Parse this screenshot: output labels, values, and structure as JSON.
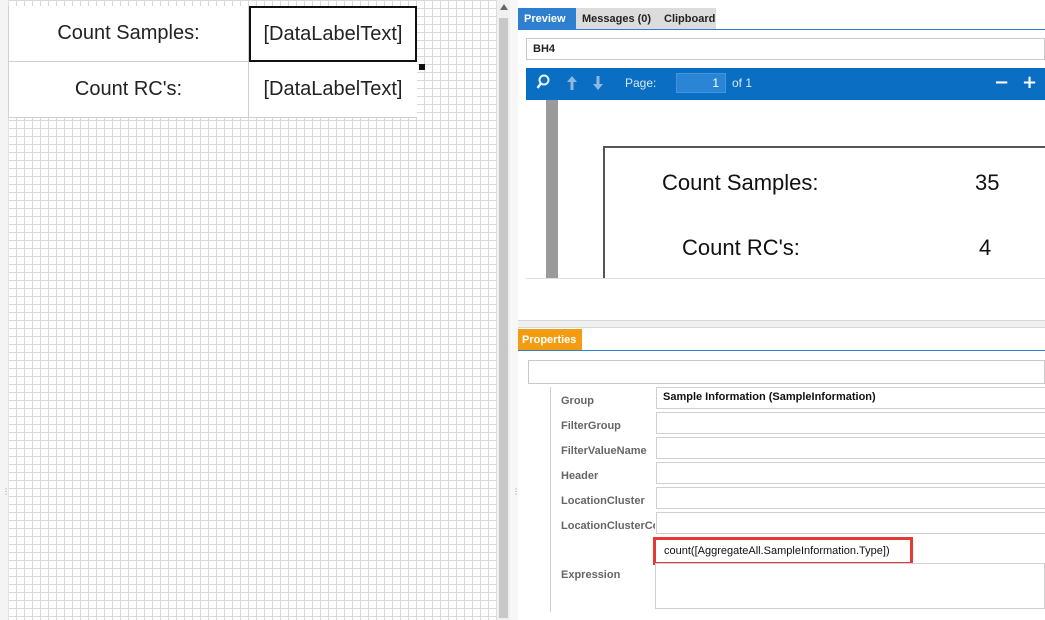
{
  "designer": {
    "rows": [
      {
        "label": "Count Samples:",
        "value": "[DataLabelText]"
      },
      {
        "label": "Count RC's:",
        "value": "[DataLabelText]"
      }
    ]
  },
  "right_tabs": [
    "Preview",
    "Messages (0)",
    "Clipboard"
  ],
  "document": {
    "selected": "BH4"
  },
  "viewer": {
    "page_label": "Page:",
    "page_number": "1",
    "page_of": "of 1",
    "zoom_out": "−",
    "zoom_in": "+"
  },
  "preview": {
    "rows": [
      {
        "label": "Count Samples:",
        "value": "35"
      },
      {
        "label": "Count RC's:",
        "value": "4"
      }
    ]
  },
  "properties": {
    "tab": "Properties",
    "search_value": "",
    "rows": [
      {
        "name": "Group",
        "value": "Sample Information (SampleInformation)"
      },
      {
        "name": "FilterGroup",
        "value": ""
      },
      {
        "name": "FilterValueName",
        "value": ""
      },
      {
        "name": "Header",
        "value": ""
      },
      {
        "name": "LocationCluster",
        "value": ""
      },
      {
        "name": "LocationClusterCo",
        "value": ""
      }
    ],
    "expression": {
      "name": "Expression",
      "value": "count([AggregateAll.SampleInformation.Type])"
    }
  },
  "icons": {
    "search": "search-icon",
    "prev": "arrow-up-icon",
    "next": "arrow-down-icon",
    "scroll_up": "scroll-up-icon"
  },
  "colors": {
    "accent": "#2f7fd0",
    "toolbar": "#0a6fc2",
    "properties_tab": "#f39c12",
    "highlight": "#e53935"
  }
}
